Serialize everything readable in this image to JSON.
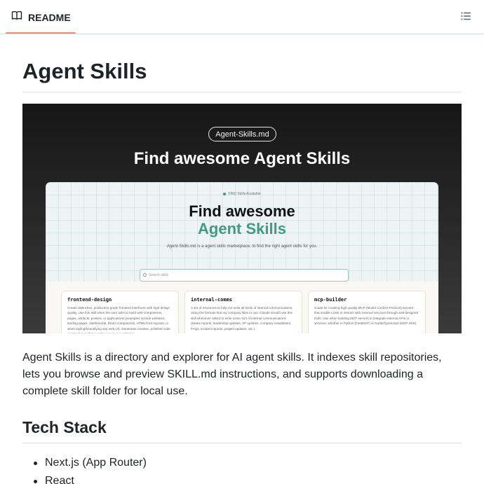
{
  "header": {
    "tab_label": "README",
    "tab_icon": "book-icon",
    "outline_icon": "list-unordered-icon",
    "accent_color": "#fd8c73"
  },
  "readme": {
    "title": "Agent Skills",
    "hero": {
      "pill_label": "Agent-Skills.md",
      "title": "Find awesome Agent Skills",
      "screenshot": {
        "badge": "FIND Skills Available",
        "title_line1": "Find awesome",
        "title_line2": "Agent Skills",
        "subtitle": "Agent-Skills.md is a agent skills marketplace, to find the right agent skills for you.",
        "search_placeholder": "Search skills",
        "accent_color": "#3e9b86",
        "cards": [
          {
            "title": "frontend-design",
            "description": "Create distinctive, production-grade frontend interfaces with high design quality. Use this skill when the user asks to build web components, pages, artifacts, posters, or applications (examples include websites, landing pages, dashboards, React components, HTML/CSS layouts, or when styling/beautifying any web UI). Generates creative, polished code and UI design that avoids generic AI aesthetics."
          },
          {
            "title": "internal-comms",
            "description": "A set of resources to help me write all kinds of internal communications, using the formats that my company likes to use. Claude should use this skill whenever asked to write some sort of internal communications (status reports, leadership updates, 3P updates, company newsletters, FAQs, incident reports, project updates, etc.)."
          },
          {
            "title": "mcp-builder",
            "description": "Guide for creating high-quality MCP (Model Context Protocol) servers that enable LLMs to interact with external services through well-designed tools. Use when building MCP servers to integrate external APIs or services, whether in Python (FastMCP) or Node/TypeScript (MCP SDK)."
          }
        ]
      }
    },
    "intro": "Agent Skills is a directory and explorer for AI agent skills. It indexes skill repositories, lets you browse and preview SKILL.md instructions, and supports downloading a complete skill folder for local use.",
    "tech_stack_heading": "Tech Stack",
    "tech_stack": [
      "Next.js (App Router)",
      "React"
    ]
  }
}
